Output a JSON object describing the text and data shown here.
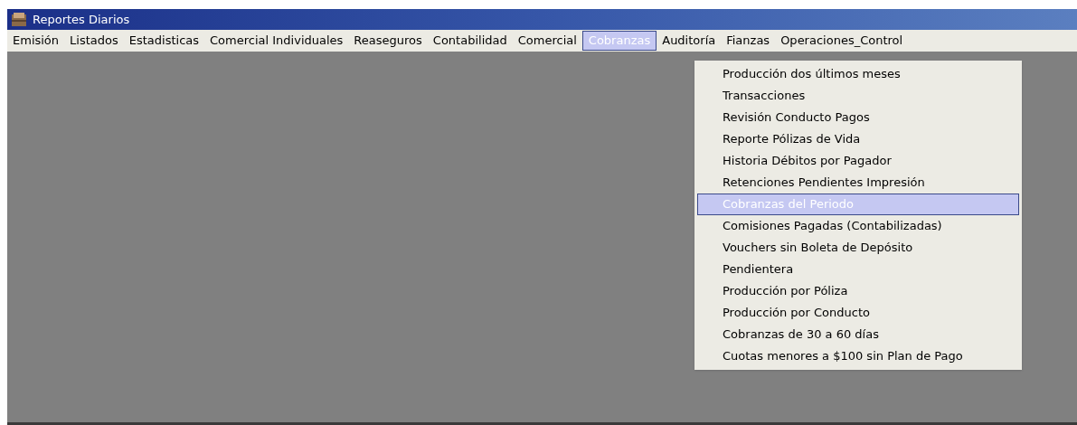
{
  "window": {
    "title": "Reportes Diarios"
  },
  "menu_bar": [
    {
      "label": "Emisión",
      "selected": false
    },
    {
      "label": "Listados",
      "selected": false
    },
    {
      "label": "Estadisticas",
      "selected": false
    },
    {
      "label": "Comercial Individuales",
      "selected": false
    },
    {
      "label": "Reaseguros",
      "selected": false
    },
    {
      "label": "Contabilidad",
      "selected": false
    },
    {
      "label": "Comercial",
      "selected": false
    },
    {
      "label": "Cobranzas",
      "selected": true
    },
    {
      "label": "Auditoría",
      "selected": false
    },
    {
      "label": "Fianzas",
      "selected": false
    },
    {
      "label": "Operaciones_Control",
      "selected": false
    }
  ],
  "dropdown": [
    {
      "label": "Producción dos últimos meses",
      "selected": false
    },
    {
      "label": "Transacciones",
      "selected": false
    },
    {
      "label": "Revisión Conducto Pagos",
      "selected": false
    },
    {
      "label": "Reporte Pólizas de Vida",
      "selected": false
    },
    {
      "label": "Historia Débitos por Pagador",
      "selected": false
    },
    {
      "label": "Retenciones Pendientes Impresión",
      "selected": false
    },
    {
      "label": "Cobranzas del Periodo",
      "selected": true
    },
    {
      "label": "Comisiones Pagadas (Contabilizadas)",
      "selected": false
    },
    {
      "label": "Vouchers sin Boleta de Depósito",
      "selected": false
    },
    {
      "label": "Pendientera",
      "selected": false
    },
    {
      "label": "Producción por Póliza",
      "selected": false
    },
    {
      "label": "Producción por Conducto",
      "selected": false
    },
    {
      "label": "Cobranzas de 30 a 60 días",
      "selected": false
    },
    {
      "label": "Cuotas menores a $100 sin Plan de Pago",
      "selected": false
    }
  ]
}
